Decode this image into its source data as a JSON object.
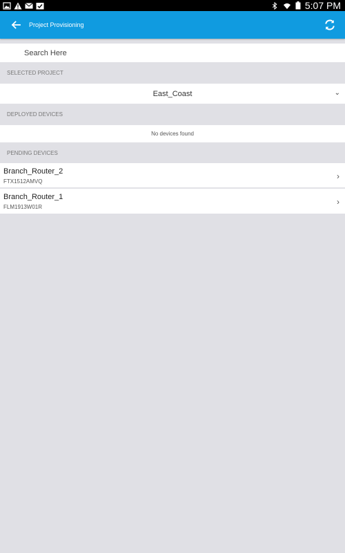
{
  "status_bar": {
    "time": "5:07 PM",
    "left_icons": [
      "image-icon",
      "warning-icon",
      "mail-icon",
      "check-icon"
    ],
    "right_icons": [
      "bluetooth-icon",
      "wifi-icon",
      "battery-icon"
    ]
  },
  "app_bar": {
    "title": "Project Provisioning",
    "background_color": "#109be0",
    "back_icon": "back-arrow-icon",
    "refresh_icon": "refresh-icon"
  },
  "search": {
    "placeholder": "Search Here"
  },
  "selected_project": {
    "header": "SELECTED PROJECT",
    "value": "East_Coast",
    "chevron": "⌄"
  },
  "deployed_devices": {
    "header": "DEPLOYED DEVICES",
    "empty_text": "No devices found"
  },
  "pending_devices": {
    "header": "PENDING DEVICES",
    "items": [
      {
        "name": "Branch_Router_2",
        "serial": "FTX1512AMVQ"
      },
      {
        "name": "Branch_Router_1",
        "serial": "FLM1913W01R"
      }
    ],
    "chevron": "›"
  }
}
